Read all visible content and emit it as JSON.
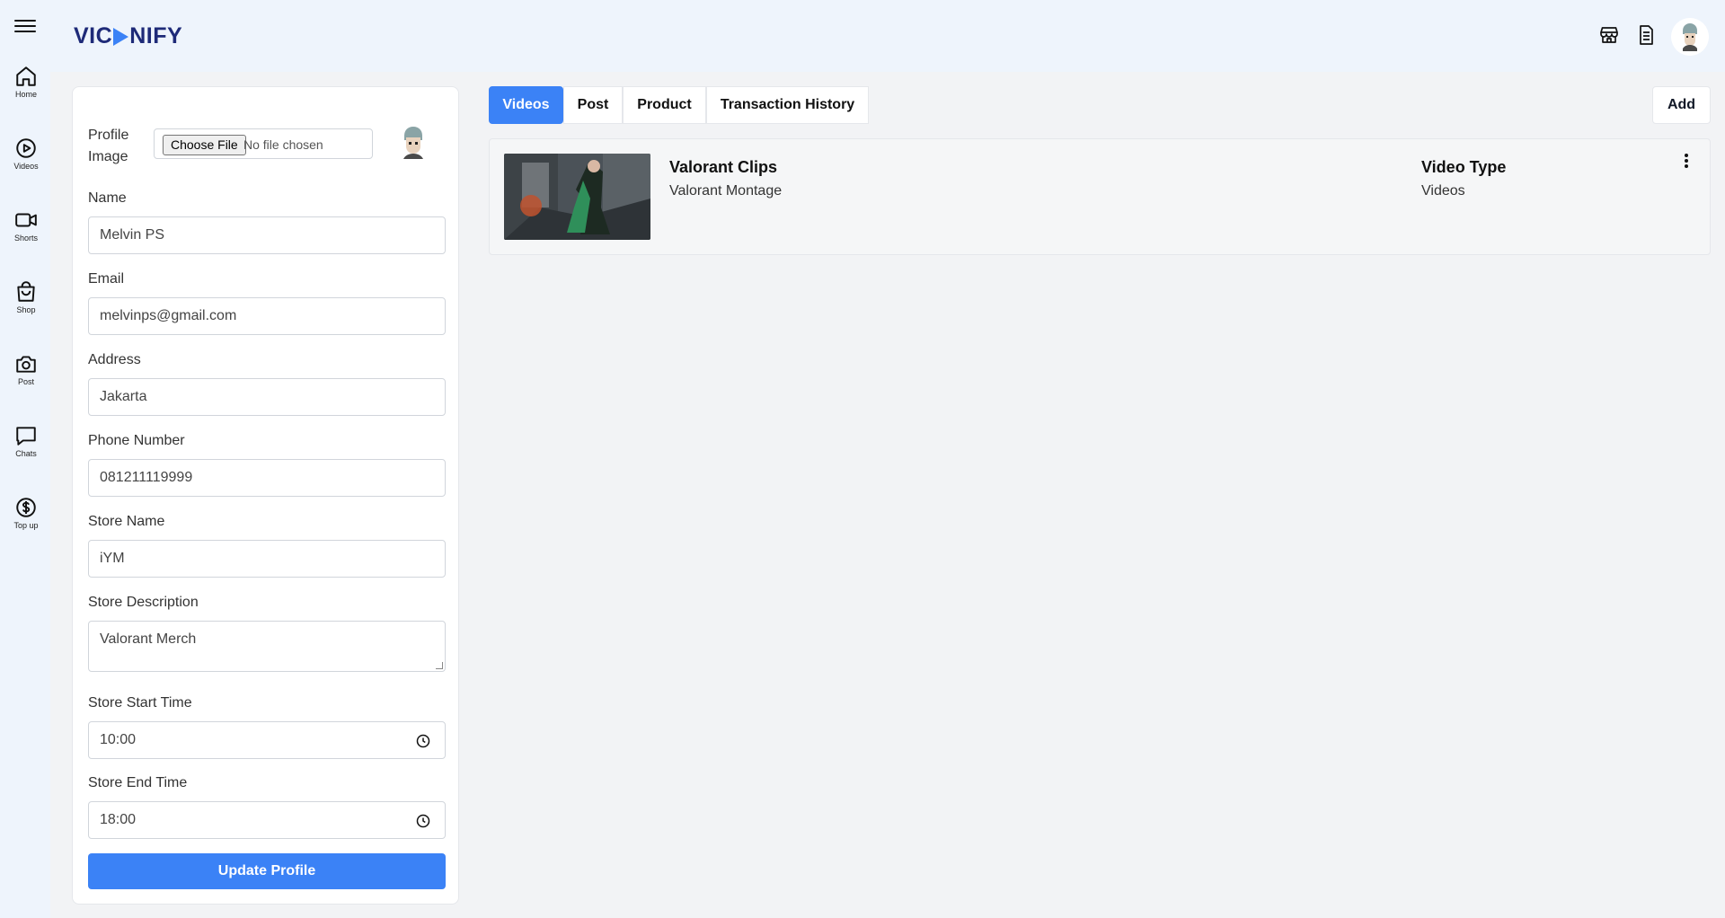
{
  "app": {
    "logo_left": "VIC",
    "logo_right": "NIFY"
  },
  "sidebar": {
    "items": [
      {
        "label": "Home",
        "icon": "home-icon"
      },
      {
        "label": "Videos",
        "icon": "play-circle-icon"
      },
      {
        "label": "Shorts",
        "icon": "video-camera-icon"
      },
      {
        "label": "Shop",
        "icon": "shopping-bag-icon"
      },
      {
        "label": "Post",
        "icon": "camera-icon"
      },
      {
        "label": "Chats",
        "icon": "chat-bubble-icon"
      },
      {
        "label": "Top up",
        "icon": "dollar-circle-icon"
      }
    ]
  },
  "header": {
    "icons": [
      "store-icon",
      "document-icon",
      "avatar"
    ]
  },
  "profile": {
    "image_label": "Profile Image",
    "choose_file": "Choose File",
    "file_status": "No file chosen",
    "name_label": "Name",
    "name_value": "Melvin PS",
    "email_label": "Email",
    "email_value": "melvinps@gmail.com",
    "address_label": "Address",
    "address_value": "Jakarta",
    "phone_label": "Phone Number",
    "phone_value": "081211119999",
    "store_name_label": "Store Name",
    "store_name_value": "iYM",
    "store_desc_label": "Store Description",
    "store_desc_value": "Valorant Merch",
    "start_time_label": "Store Start Time",
    "start_time_value": "10:00",
    "end_time_label": "Store End Time",
    "end_time_value": "18:00",
    "update_button": "Update Profile"
  },
  "tabs": [
    {
      "label": "Videos",
      "active": true
    },
    {
      "label": "Post",
      "active": false
    },
    {
      "label": "Product",
      "active": false
    },
    {
      "label": "Transaction History",
      "active": false
    }
  ],
  "add_button": "Add",
  "videos": [
    {
      "title": "Valorant Clips",
      "description": "Valorant Montage",
      "type_label": "Video Type",
      "type_value": "Videos"
    }
  ],
  "colors": {
    "accent": "#3b82f6",
    "header_bg": "#eef4fc",
    "content_bg": "#f2f3f5",
    "logo": "#1e2a78"
  }
}
